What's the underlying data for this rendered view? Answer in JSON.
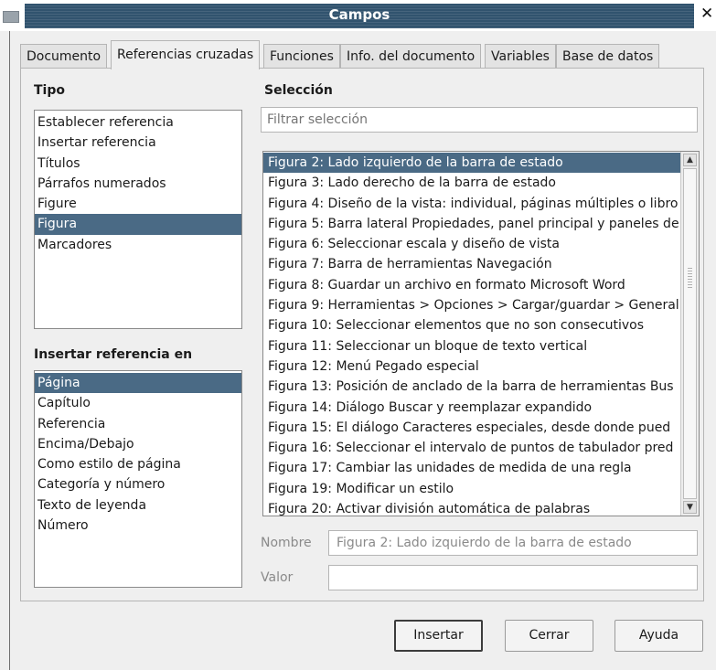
{
  "window": {
    "title": "Campos",
    "close_glyph": "✕",
    "icon": "window-menu-icon"
  },
  "tabs": [
    {
      "label": "Documento",
      "active": false
    },
    {
      "label": "Referencias cruzadas",
      "active": true
    },
    {
      "label": "Funciones",
      "active": false
    },
    {
      "label": "Info. del documento",
      "active": false
    },
    {
      "label": "Variables",
      "active": false
    },
    {
      "label": "Base de datos",
      "active": false
    }
  ],
  "tipo": {
    "heading": "Tipo",
    "items": [
      "Establecer referencia",
      "Insertar referencia",
      "Títulos",
      "Párrafos numerados",
      "Figure",
      "Figura",
      "Marcadores"
    ],
    "selected_index": 5
  },
  "insertar": {
    "heading": "Insertar referencia en",
    "items": [
      "Página",
      "Capítulo",
      "Referencia",
      "Encima/Debajo",
      "Como estilo de página",
      "Categoría y número",
      "Texto de leyenda",
      "Número"
    ],
    "selected_index": 0
  },
  "seleccion": {
    "heading": "Selección",
    "filter_placeholder": "Filtrar selección",
    "items": [
      "Figura 2: Lado izquierdo de la barra de estado",
      "Figura 3: Lado derecho de la barra de estado",
      "Figura 4: Diseño de la vista: individual, páginas múltiples o libro",
      "Figura 5: Barra lateral Propiedades, panel principal  y paneles de",
      "Figura 6: Seleccionar escala y diseño de vista",
      "Figura 7: Barra de herramientas Navegación",
      "Figura 8: Guardar un archivo en formato Microsoft Word",
      "Figura 9: Herramientas > Opciones > Cargar/guardar > General",
      "Figura 10: Seleccionar elementos que no son consecutivos",
      "Figura 11: Seleccionar un bloque de texto  vertical",
      "Figura 12: Menú Pegado especial",
      "Figura 13: Posición de anclado de la barra de herramientas Bus",
      "Figura 14: Diálogo Buscar y reemplazar expandido",
      "Figura 15: El diálogo Caracteres especiales, desde donde pued",
      "Figura 16: Seleccionar el intervalo de puntos de tabulador pred",
      "Figura 17: Cambiar las unidades de medida de una regla",
      "Figura 19: Modificar un estilo",
      "Figura 20: Activar división automática de palabras"
    ],
    "selected_index": 0,
    "scroll_up_glyph": "▲",
    "scroll_down_glyph": "▼"
  },
  "fields": {
    "nombre_label": "Nombre",
    "nombre_value": "Figura 2: Lado izquierdo de la barra de estado",
    "valor_label": "Valor",
    "valor_value": ""
  },
  "buttons": {
    "insert": "Insertar",
    "close": "Cerrar",
    "help": "Ayuda"
  },
  "colors": {
    "title_bar": "#31536e",
    "selection": "#4a6a85"
  }
}
